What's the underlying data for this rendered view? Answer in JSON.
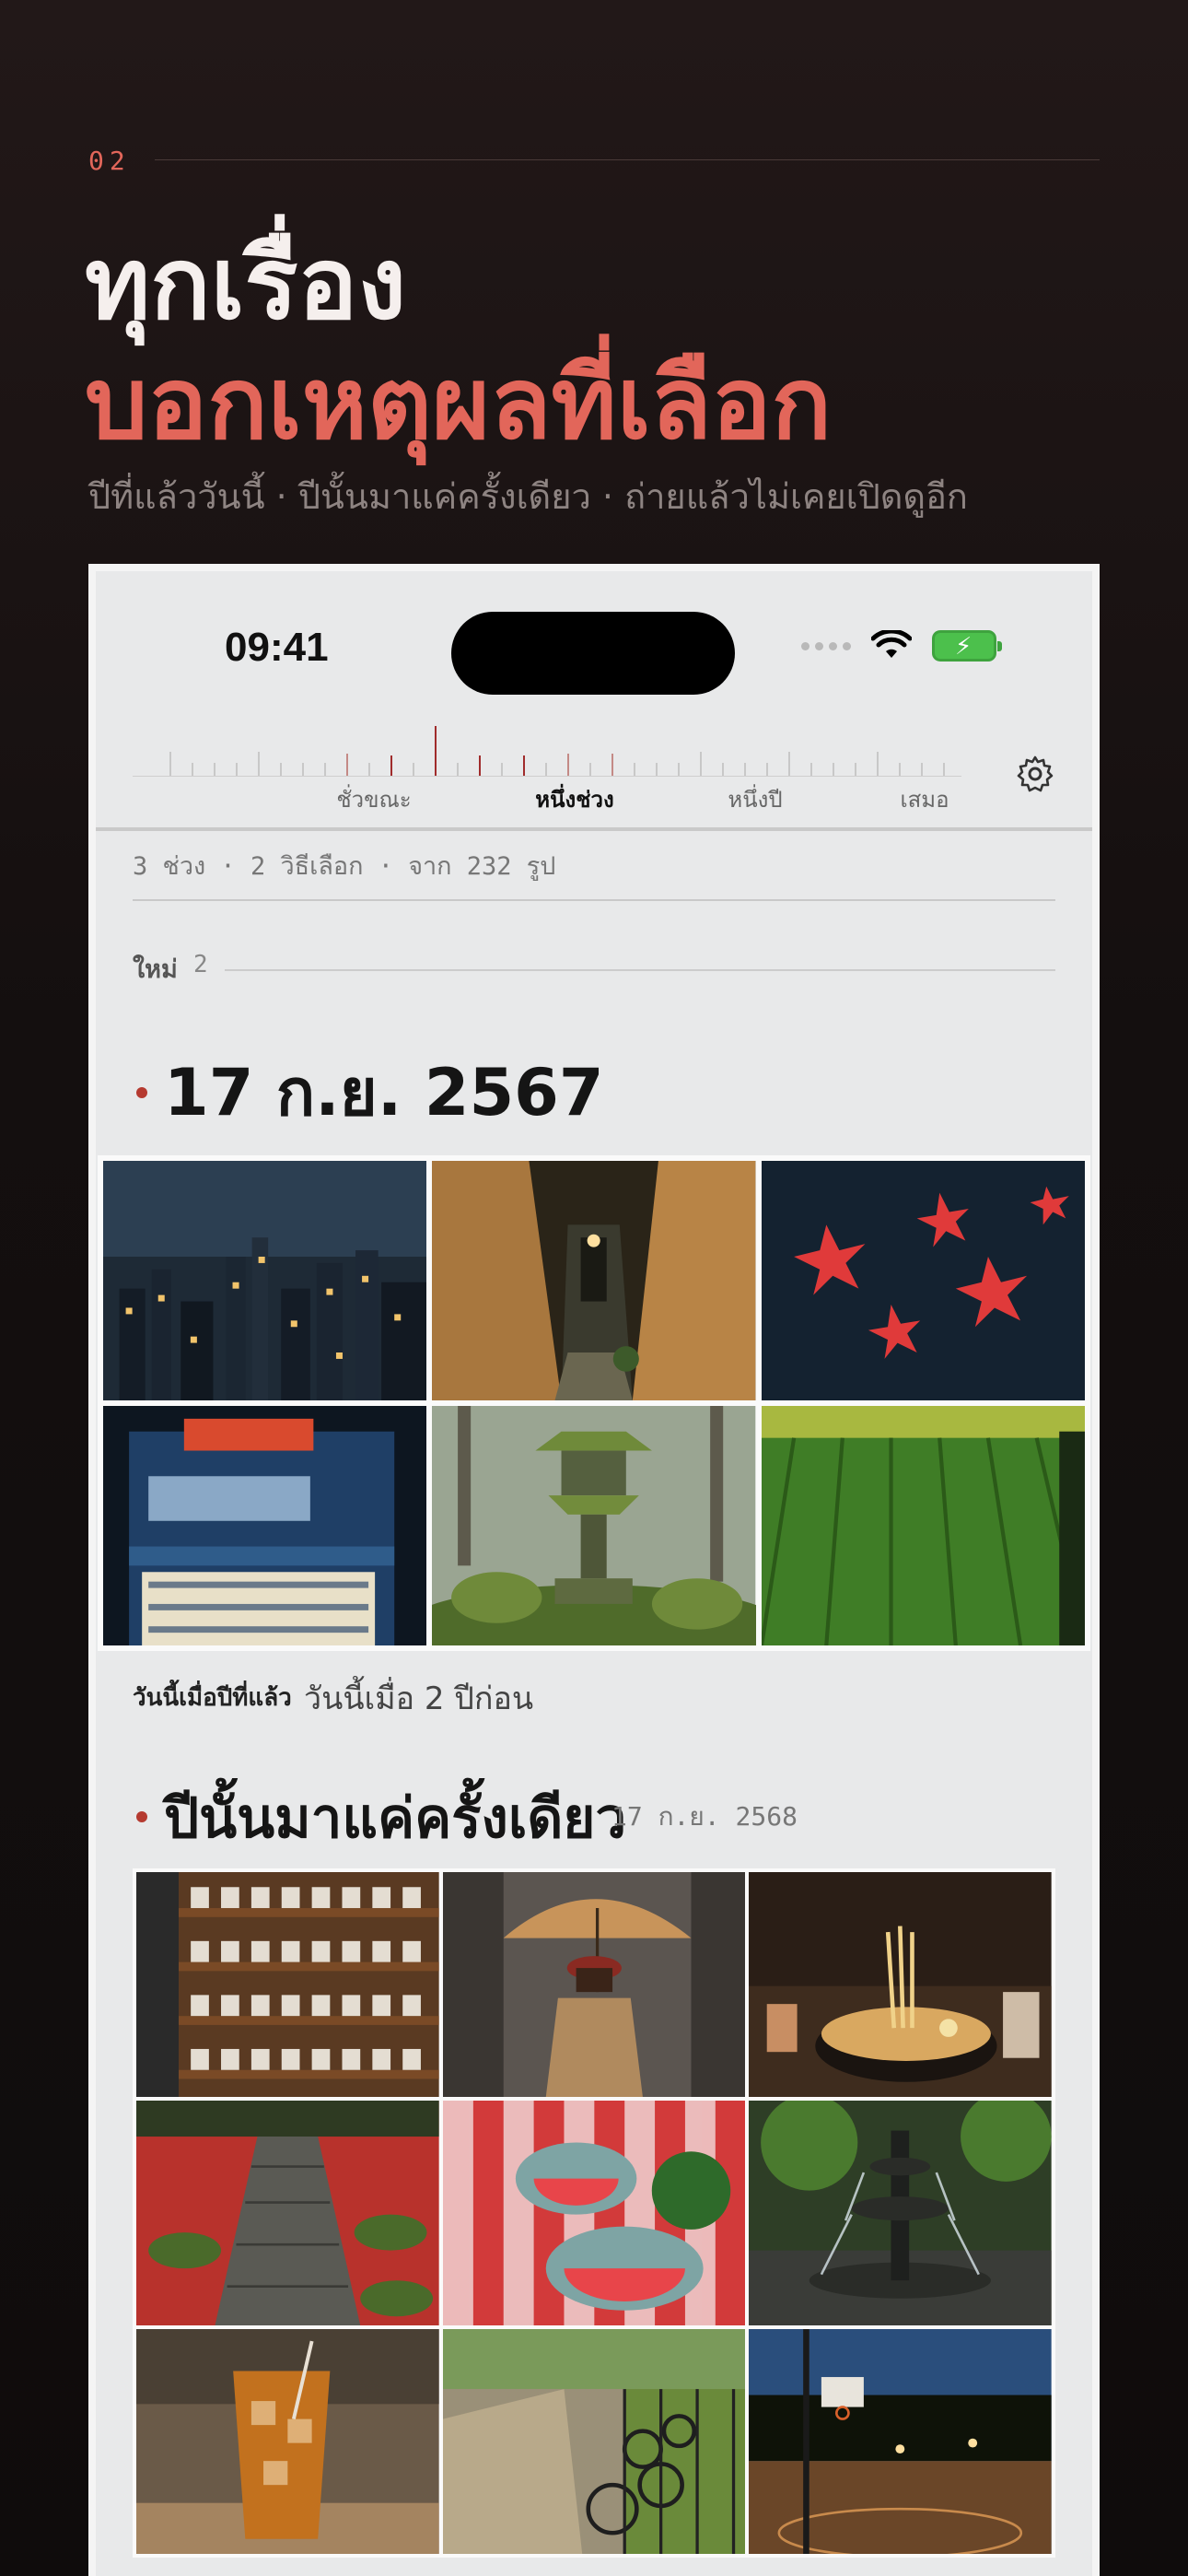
{
  "section": {
    "number": "02"
  },
  "headline": {
    "line1": "ทุกเรื่อง",
    "line2": "บอกเหตุผลที่เลือก",
    "subline": "ปีที่แล้ววันนี้ · ปีนั้นมาแค่ครั้งเดียว · ถ่ายแล้วไม่เคยเปิดดูอีก"
  },
  "colors": {
    "accent": "#e2665a",
    "bullet": "#b53a30",
    "battery": "#4cc04c"
  },
  "status_bar": {
    "time": "09:41",
    "icons": [
      "signal-dots-icon",
      "wifi-icon",
      "battery-charging-icon"
    ]
  },
  "time_scale": {
    "labels": [
      "ชั่วขณะ",
      "หนึ่งช่วง",
      "หนึ่งปี",
      "เสมอ"
    ],
    "selected": "หนึ่งช่วง"
  },
  "summary": {
    "text": "3 ช่วง · 2 วิธีเลือก · จาก 232 รูป"
  },
  "new_group": {
    "label": "ใหม่",
    "count": "2"
  },
  "section_a": {
    "date": "17 ก.ย. 2567",
    "photos": [
      "night-city-skyline",
      "narrow-alley",
      "red-maple-leaves",
      "convenience-store",
      "mossy-stone-lantern",
      "rice-paddy"
    ],
    "reason_small": "วันนี้เมื่อปีที่แล้ว",
    "reason_big": "วันนี้เมื่อ 2 ปีก่อน"
  },
  "section_b": {
    "title": "ปีนั้นมาแค่ครั้งเดียว",
    "date": "17 ก.ย. 2568",
    "photos": [
      "cup-shelves",
      "umbrella-street",
      "noodle-bowl",
      "leafy-stone-path",
      "watermelon-picnic",
      "park-fountain",
      "iced-tea",
      "bicycles-walkway",
      "basketball-court-night"
    ]
  }
}
